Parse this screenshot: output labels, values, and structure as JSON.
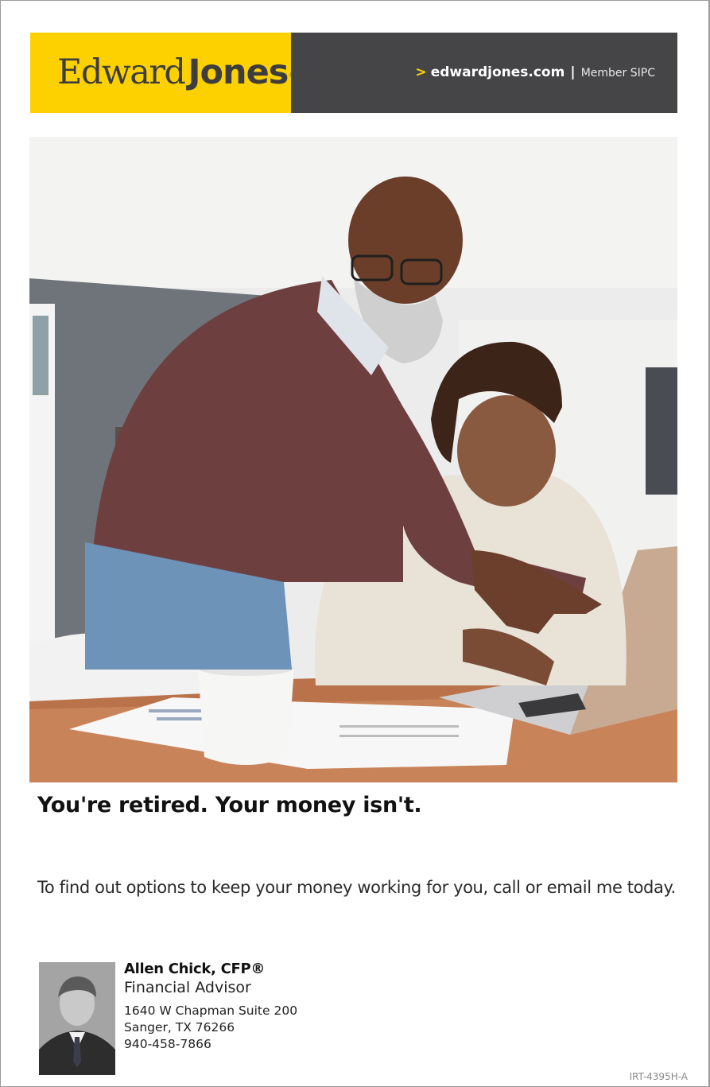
{
  "banner": {
    "logo_word_1": "Edward",
    "logo_word_2": "Jones",
    "logo_mark": "®",
    "link_chevron": ">",
    "website": "edwardjones.com",
    "separator": "|",
    "member": "Member SIPC",
    "colors": {
      "brand_yellow": "#fdd100",
      "banner_gray": "#454547"
    }
  },
  "headline": "You're retired. Your money isn't.",
  "subline": "To find out options to keep your money working for you, call or email me today.",
  "advisor": {
    "name": "Allen Chick, CFP®",
    "title": "Financial Advisor",
    "address_line_1": "1640 W Chapman Suite 200",
    "address_line_2": "Sanger, TX 76266",
    "phone": "940-458-7866"
  },
  "footer_code": "IRT-4395H-A"
}
